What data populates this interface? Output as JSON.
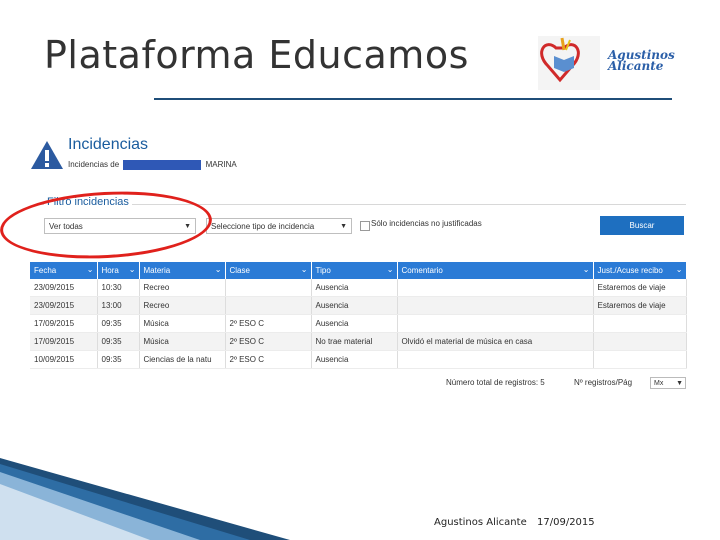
{
  "slide": {
    "title": "Plataforma Educamos",
    "footer_left": "Agustinos Alicante",
    "footer_right": "17/09/2015",
    "logo_line1": "Agustinos",
    "logo_line2": "Alicante"
  },
  "incidencias": {
    "title": "Incidencias",
    "subtitle_prefix": "Incidencias de",
    "subtitle_suffix": "MARINA",
    "filter_legend": "Filtro incidencias",
    "select_all": "Ver todas",
    "select_type": "Seleccione tipo de incidencia",
    "only_unjustified": "Sólo incidencias no justificadas",
    "search_button": "Buscar"
  },
  "table": {
    "columns": [
      "Fecha",
      "Hora",
      "Materia",
      "Clase",
      "Tipo",
      "Comentario",
      "Just./Acuse recibo"
    ],
    "rows": [
      [
        "23/09/2015",
        "10:30",
        "Recreo",
        "",
        "Ausencia",
        "",
        "Estaremos de viaje"
      ],
      [
        "23/09/2015",
        "13:00",
        "Recreo",
        "",
        "Ausencia",
        "",
        "Estaremos de viaje"
      ],
      [
        "17/09/2015",
        "09:35",
        "Música",
        "2º ESO C",
        "Ausencia",
        "",
        ""
      ],
      [
        "17/09/2015",
        "09:35",
        "Música",
        "2º ESO C",
        "No trae material",
        "Olvidó el material de música en casa",
        ""
      ],
      [
        "10/09/2015",
        "09:35",
        "Ciencias de la natu",
        "2º ESO C",
        "Ausencia",
        "",
        ""
      ]
    ]
  },
  "footer": {
    "total_label": "Número total de registros: 5",
    "per_page_label": "Nº registros/Pág",
    "per_page_value": "Mx"
  },
  "colors": {
    "accent": "#2b7bd6",
    "button": "#1e6fc0",
    "highlight_circle": "#e0211c",
    "title_rule": "#1f4e79"
  }
}
